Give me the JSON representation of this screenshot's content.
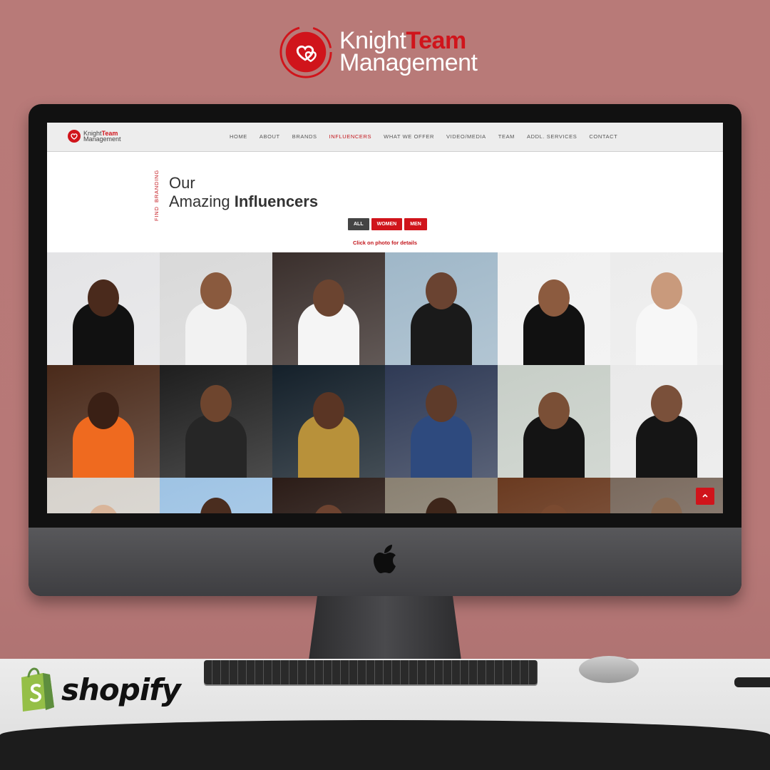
{
  "brand": {
    "name_knight": "Knight",
    "name_team": "Team",
    "name_management": "Management",
    "accent": "#d0141b"
  },
  "nav": {
    "logo_knight": "Knight",
    "logo_team": "Team",
    "logo_management": "Management",
    "items": [
      "HOME",
      "ABOUT",
      "BRANDS",
      "INFLUENCERS",
      "WHAT WE OFFER",
      "VIDEO/MEDIA",
      "TEAM",
      "ADDL. SERVICES",
      "CONTACT"
    ],
    "active": "INFLUENCERS"
  },
  "hero": {
    "side_tag_1": "FIND",
    "side_tag_2": "BRANDING",
    "line1": "Our",
    "line2_light": "Amazing",
    "line2_bold": "Influencers"
  },
  "filters": {
    "all": "ALL",
    "women": "WOMEN",
    "men": "MEN"
  },
  "hint": "Click on photo for details",
  "photos": [
    {
      "bg": "#e4e4e6",
      "skin": "#4a2a1c",
      "outfit": "#111"
    },
    {
      "bg": "#d9d9d9",
      "skin": "#8a5a3e",
      "outfit": "#f2f2f2"
    },
    {
      "bg": "#3a2f2c",
      "skin": "#6b4430",
      "outfit": "#f5f5f5"
    },
    {
      "bg": "#9fb7c8",
      "skin": "#6a4331",
      "outfit": "#1a1a1a"
    },
    {
      "bg": "#f0f0f0",
      "skin": "#8c5b3f",
      "outfit": "#111"
    },
    {
      "bg": "#ececec",
      "skin": "#c99a7c",
      "outfit": "#f7f7f7"
    },
    {
      "bg": "#4a2a1a",
      "skin": "#3a2015",
      "outfit": "#ef6a1f"
    },
    {
      "bg": "#1e1e1e",
      "skin": "#6e452e",
      "outfit": "#262626"
    },
    {
      "bg": "#14202a",
      "skin": "#5a3524",
      "outfit": "#b8913a"
    },
    {
      "bg": "#2f3a55",
      "skin": "#5e3b2a",
      "outfit": "#2e4a7e"
    },
    {
      "bg": "#c7cec7",
      "skin": "#7a4f36",
      "outfit": "#141414"
    },
    {
      "bg": "#e9e9e9",
      "skin": "#7a503a",
      "outfit": "#151515"
    },
    {
      "bg": "#d6d2cc",
      "skin": "#d9b59a",
      "outfit": "#f1e4d8"
    },
    {
      "bg": "#9ec3e4",
      "skin": "#4a2d1f",
      "outfit": "#e8e8e8"
    },
    {
      "bg": "#2b1c17",
      "skin": "#6d4330",
      "outfit": "#c0161c"
    },
    {
      "bg": "#8a8172",
      "skin": "#3e261a",
      "outfit": "#222"
    },
    {
      "bg": "#6a3a20",
      "skin": "#7a4a30",
      "outfit": "#1b1b1b"
    },
    {
      "bg": "#7a6a5e",
      "skin": "#8a6a52",
      "outfit": "#2a2a2a"
    }
  ],
  "back_to_top_icon": "chevron-up-icon",
  "footer_logo": {
    "text": "shopify",
    "color": "#95bf47"
  }
}
